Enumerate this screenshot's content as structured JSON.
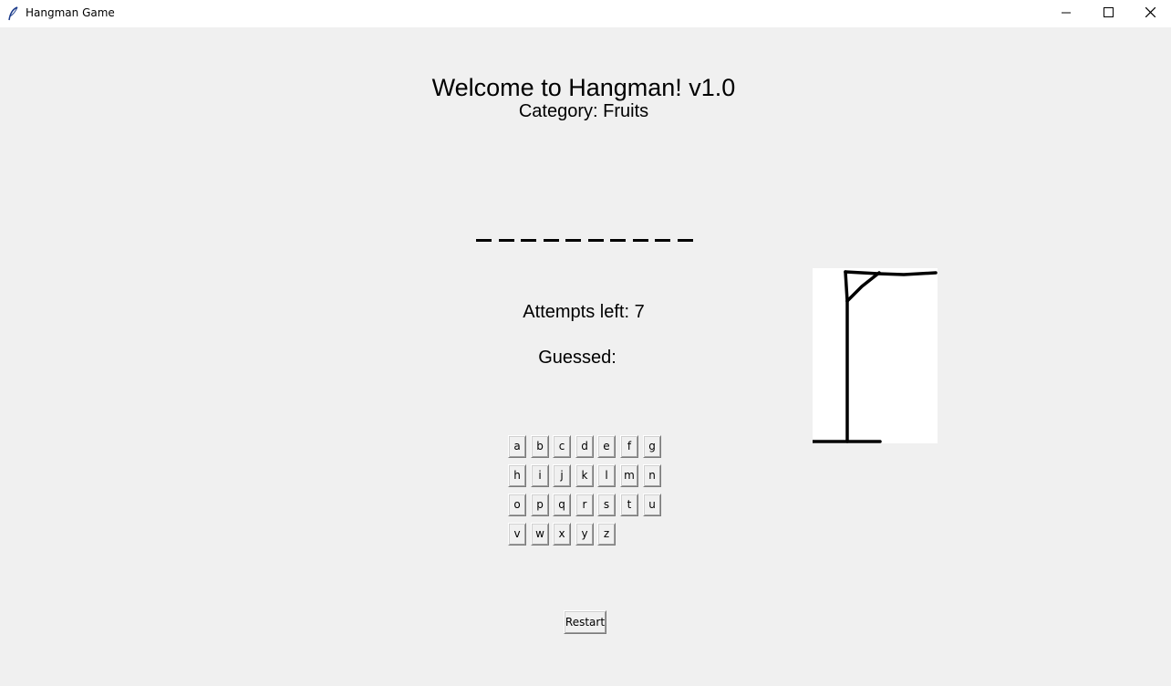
{
  "window": {
    "title": "Hangman Game",
    "app_icon": "feather-icon",
    "controls": [
      "minimize-icon",
      "maximize-icon",
      "close-icon"
    ]
  },
  "game": {
    "heading": "Welcome to Hangman! v1.0",
    "category": "Category: Fruits",
    "word_blanks": [
      "_",
      "_",
      "_",
      "_",
      "_",
      "_",
      "_",
      "_",
      "_",
      "_"
    ],
    "attempts": "Attempts left: 7",
    "guessed_label": "Guessed:",
    "guessed_value": ""
  },
  "keyboard": {
    "rows": [
      [
        "a",
        "b",
        "c",
        "d",
        "e",
        "f",
        "g"
      ],
      [
        "h",
        "i",
        "j",
        "k",
        "l",
        "m",
        "n"
      ],
      [
        "o",
        "p",
        "q",
        "r",
        "s",
        "t",
        "u"
      ],
      [
        "v",
        "w",
        "x",
        "y",
        "z"
      ]
    ]
  },
  "restart_label": "Restart",
  "colors": {
    "background": "#f0f0f0",
    "canvas": "#ffffff",
    "ink": "#000000"
  }
}
